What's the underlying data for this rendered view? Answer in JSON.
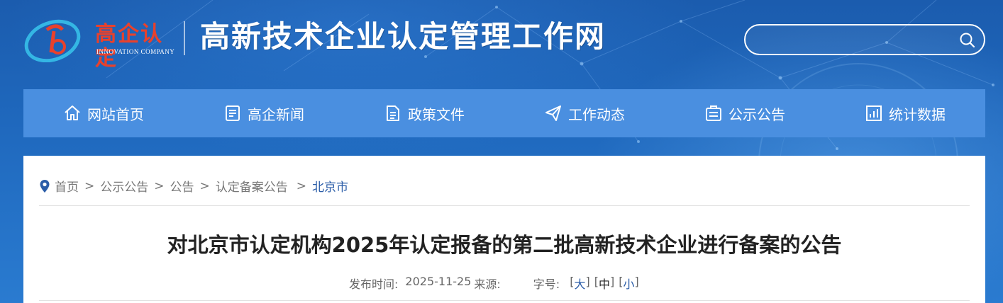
{
  "header": {
    "logo_text": "高企认定",
    "logo_sub": "INNOVATION COMPANY",
    "site_title": "高新技术企业认定管理工作网",
    "search_placeholder": ""
  },
  "nav": {
    "items": [
      {
        "label": "网站首页",
        "icon": "home-icon"
      },
      {
        "label": "高企新闻",
        "icon": "news-icon"
      },
      {
        "label": "政策文件",
        "icon": "document-icon"
      },
      {
        "label": "工作动态",
        "icon": "send-icon"
      },
      {
        "label": "公示公告",
        "icon": "notice-icon"
      },
      {
        "label": "统计数据",
        "icon": "chart-icon"
      }
    ]
  },
  "breadcrumb": {
    "items": [
      "首页",
      "公示公告",
      "公告",
      "认定备案公告",
      "北京市"
    ],
    "separator": ">"
  },
  "article": {
    "title": "对北京市认定机构2025年认定报备的第二批高新技术企业进行备案的公告",
    "publish_label": "发布时间:",
    "publish_date": "2025-11-25",
    "source_label": "来源:",
    "fontsize_label": "字号:",
    "size_large": "大",
    "size_medium": "中",
    "size_small": "小"
  },
  "colors": {
    "nav_bg": "#4a8fe0",
    "header_bg": "#1b5cae",
    "logo_red": "#e8412c",
    "link_blue": "#2b5da8"
  }
}
